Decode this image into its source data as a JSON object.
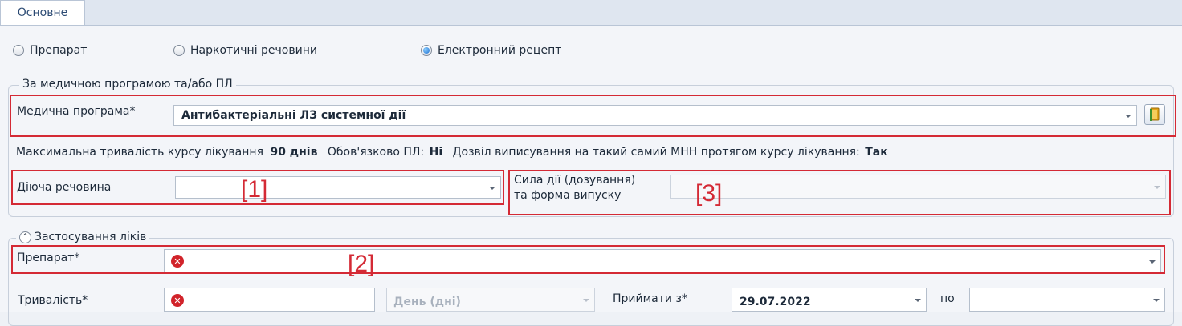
{
  "tabs": {
    "main_label": "Основне"
  },
  "radios": [
    {
      "label": "Препарат",
      "selected": false
    },
    {
      "label": "Наркотичні речовини",
      "selected": false
    },
    {
      "label": "Електронний рецепт",
      "selected": true
    }
  ],
  "program_group": {
    "legend": "За медичною програмою та/або ПЛ",
    "medical_program_label": "Медична програма*",
    "medical_program_value": "Антибактеріальні ЛЗ системної дії",
    "info": {
      "max_duration_label": "Максимальна тривалість курсу лікування",
      "max_duration_value": "90 днів",
      "pl_required_label": "Обов'язково ПЛ:",
      "pl_required_value": "Ні",
      "permission_label": "Дозвіл виписування на такий самий МНН протягом курсу лікування:",
      "permission_value": "Так"
    },
    "active_substance_label": "Діюча речовина",
    "strength_label_line1": "Сила дії (дозування)",
    "strength_label_line2": "та форма випуску"
  },
  "usage_group": {
    "legend": "Застосування ліків",
    "drug_label": "Препарат*",
    "duration_label": "Тривалість*",
    "duration_unit": "День (дні)",
    "take_from_label": "Приймати з*",
    "take_from_value": "29.07.2022",
    "to_label": "по"
  },
  "annotations": {
    "a1": "[1]",
    "a2": "[2]",
    "a3": "[3]"
  },
  "colors": {
    "annotation_red": "#d42a35",
    "error_red": "#d1232a",
    "accent_blue": "#1c6fd1"
  }
}
